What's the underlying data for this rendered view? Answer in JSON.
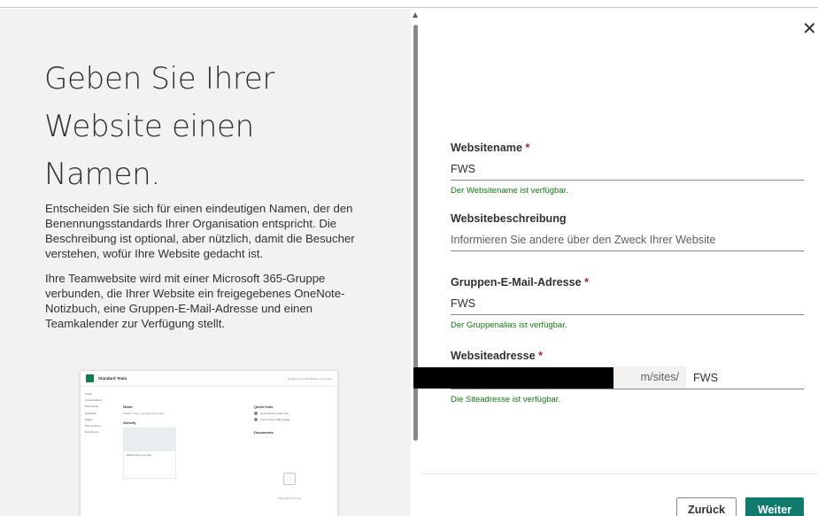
{
  "left": {
    "heading": "Geben Sie Ihrer Website einen Namen.",
    "paragraph1": "Entscheiden Sie sich für einen eindeutigen Namen, der den Benennungsstandards Ihrer Organisation entspricht. Die Beschreibung ist optional, aber nützlich, damit die Besucher verstehen, wofür Ihre Website gedacht ist.",
    "paragraph2": "Ihre Teamwebsite wird mit einer Microsoft 365-Gruppe verbunden, die Ihrer Website ein freigegebenes OneNote-Notizbuch, eine Gruppen-E-Mail-Adresse und einen Teamkalender zur Verfügung stellt.",
    "preview": {
      "site_title": "Standard Team",
      "header_right": "Private group  Not following  1 member",
      "nav": [
        "Home",
        "Conversations",
        "Documents",
        "Notebook",
        "Pages",
        "Site contents",
        "Recycle bin"
      ],
      "news_heading": "News",
      "news_text": "Details: Keep your team up to date.",
      "activity_heading": "Activity",
      "card_text": "Welcome to your site",
      "quick_links_heading": "Quick links",
      "quick_links": [
        "Learn about a team site",
        "Learn how to add a page"
      ],
      "documents_heading": "Documents",
      "empty_text": "This folder is empty"
    }
  },
  "form": {
    "close_icon": "close-icon",
    "site_name": {
      "label": "Websitename",
      "required": "*",
      "value": "FWS",
      "status": "Der Websitename ist verfügbar."
    },
    "description": {
      "label": "Websitebeschreibung",
      "placeholder": "Informieren Sie andere über den Zweck Ihrer Website"
    },
    "group_email": {
      "label": "Gruppen-E-Mail-Adresse",
      "required": "*",
      "value": "FWS",
      "status": "Der Gruppenalias ist verfügbar."
    },
    "site_address": {
      "label": "Websiteadresse",
      "required": "*",
      "prefix": "m/sites/",
      "value": "FWS",
      "status": "Die Siteadresse ist verfügbar."
    }
  },
  "footer": {
    "back_label": "Zurück",
    "next_label": "Weiter"
  },
  "colors": {
    "accent": "#0f7b6c",
    "success": "#107c10",
    "required": "#a4262c"
  }
}
